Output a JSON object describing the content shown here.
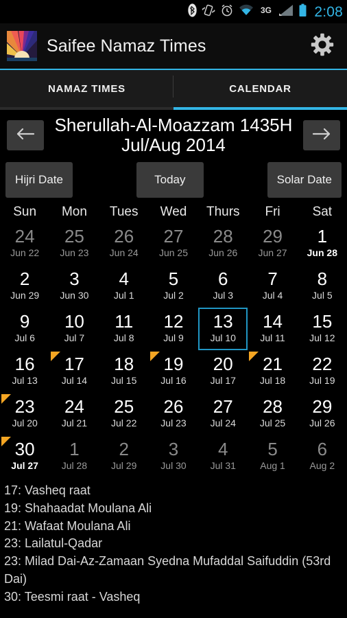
{
  "statusbar": {
    "time": "2:08",
    "icons": [
      "bluetooth-icon",
      "vibrate-icon",
      "alarm-icon",
      "wifi-icon",
      "network-3g-icon",
      "signal-icon",
      "battery-icon"
    ]
  },
  "actionbar": {
    "title": "Saifee Namaz Times",
    "logo_name": "app-logo-sunrise",
    "settings_label": "gear-icon"
  },
  "tabs": [
    {
      "label": "NAMAZ TIMES",
      "active": false
    },
    {
      "label": "CALENDAR",
      "active": true
    }
  ],
  "monthbar": {
    "prev_label": "←",
    "next_label": "→",
    "title_line1": "Sherullah-Al-Moazzam 1435H",
    "title_line2": "Jul/Aug 2014"
  },
  "modebar": {
    "hijri": "Hijri Date",
    "today": "Today",
    "solar": "Solar Date"
  },
  "calendar": {
    "weekdays": [
      "Sun",
      "Mon",
      "Tues",
      "Wed",
      "Thurs",
      "Fri",
      "Sat"
    ],
    "weeks": [
      [
        {
          "hijri": "24",
          "solar": "Jun 22",
          "out": true,
          "today": false,
          "marker": false,
          "bold": false
        },
        {
          "hijri": "25",
          "solar": "Jun 23",
          "out": true,
          "today": false,
          "marker": false,
          "bold": false
        },
        {
          "hijri": "26",
          "solar": "Jun 24",
          "out": true,
          "today": false,
          "marker": false,
          "bold": false
        },
        {
          "hijri": "27",
          "solar": "Jun 25",
          "out": true,
          "today": false,
          "marker": false,
          "bold": false
        },
        {
          "hijri": "28",
          "solar": "Jun 26",
          "out": true,
          "today": false,
          "marker": false,
          "bold": false
        },
        {
          "hijri": "29",
          "solar": "Jun 27",
          "out": true,
          "today": false,
          "marker": false,
          "bold": false
        },
        {
          "hijri": "1",
          "solar": "Jun 28",
          "out": false,
          "today": false,
          "marker": false,
          "bold": true
        }
      ],
      [
        {
          "hijri": "2",
          "solar": "Jun 29",
          "out": false,
          "today": false,
          "marker": false,
          "bold": false
        },
        {
          "hijri": "3",
          "solar": "Jun 30",
          "out": false,
          "today": false,
          "marker": false,
          "bold": false
        },
        {
          "hijri": "4",
          "solar": "Jul 1",
          "out": false,
          "today": false,
          "marker": false,
          "bold": false
        },
        {
          "hijri": "5",
          "solar": "Jul 2",
          "out": false,
          "today": false,
          "marker": false,
          "bold": false
        },
        {
          "hijri": "6",
          "solar": "Jul 3",
          "out": false,
          "today": false,
          "marker": false,
          "bold": false
        },
        {
          "hijri": "7",
          "solar": "Jul 4",
          "out": false,
          "today": false,
          "marker": false,
          "bold": false
        },
        {
          "hijri": "8",
          "solar": "Jul 5",
          "out": false,
          "today": false,
          "marker": false,
          "bold": false
        }
      ],
      [
        {
          "hijri": "9",
          "solar": "Jul 6",
          "out": false,
          "today": false,
          "marker": false,
          "bold": false
        },
        {
          "hijri": "10",
          "solar": "Jul 7",
          "out": false,
          "today": false,
          "marker": false,
          "bold": false
        },
        {
          "hijri": "11",
          "solar": "Jul 8",
          "out": false,
          "today": false,
          "marker": false,
          "bold": false
        },
        {
          "hijri": "12",
          "solar": "Jul 9",
          "out": false,
          "today": false,
          "marker": false,
          "bold": false
        },
        {
          "hijri": "13",
          "solar": "Jul 10",
          "out": false,
          "today": true,
          "marker": false,
          "bold": false
        },
        {
          "hijri": "14",
          "solar": "Jul 11",
          "out": false,
          "today": false,
          "marker": false,
          "bold": false
        },
        {
          "hijri": "15",
          "solar": "Jul 12",
          "out": false,
          "today": false,
          "marker": false,
          "bold": false
        }
      ],
      [
        {
          "hijri": "16",
          "solar": "Jul 13",
          "out": false,
          "today": false,
          "marker": false,
          "bold": false
        },
        {
          "hijri": "17",
          "solar": "Jul 14",
          "out": false,
          "today": false,
          "marker": true,
          "bold": false
        },
        {
          "hijri": "18",
          "solar": "Jul 15",
          "out": false,
          "today": false,
          "marker": false,
          "bold": false
        },
        {
          "hijri": "19",
          "solar": "Jul 16",
          "out": false,
          "today": false,
          "marker": true,
          "bold": false
        },
        {
          "hijri": "20",
          "solar": "Jul 17",
          "out": false,
          "today": false,
          "marker": false,
          "bold": false
        },
        {
          "hijri": "21",
          "solar": "Jul 18",
          "out": false,
          "today": false,
          "marker": true,
          "bold": false
        },
        {
          "hijri": "22",
          "solar": "Jul 19",
          "out": false,
          "today": false,
          "marker": false,
          "bold": false
        }
      ],
      [
        {
          "hijri": "23",
          "solar": "Jul 20",
          "out": false,
          "today": false,
          "marker": true,
          "bold": false
        },
        {
          "hijri": "24",
          "solar": "Jul 21",
          "out": false,
          "today": false,
          "marker": false,
          "bold": false
        },
        {
          "hijri": "25",
          "solar": "Jul 22",
          "out": false,
          "today": false,
          "marker": false,
          "bold": false
        },
        {
          "hijri": "26",
          "solar": "Jul 23",
          "out": false,
          "today": false,
          "marker": false,
          "bold": false
        },
        {
          "hijri": "27",
          "solar": "Jul 24",
          "out": false,
          "today": false,
          "marker": false,
          "bold": false
        },
        {
          "hijri": "28",
          "solar": "Jul 25",
          "out": false,
          "today": false,
          "marker": false,
          "bold": false
        },
        {
          "hijri": "29",
          "solar": "Jul 26",
          "out": false,
          "today": false,
          "marker": false,
          "bold": false
        }
      ],
      [
        {
          "hijri": "30",
          "solar": "Jul 27",
          "out": false,
          "today": false,
          "marker": true,
          "bold": true
        },
        {
          "hijri": "1",
          "solar": "Jul 28",
          "out": true,
          "today": false,
          "marker": false,
          "bold": false
        },
        {
          "hijri": "2",
          "solar": "Jul 29",
          "out": true,
          "today": false,
          "marker": false,
          "bold": false
        },
        {
          "hijri": "3",
          "solar": "Jul 30",
          "out": true,
          "today": false,
          "marker": false,
          "bold": false
        },
        {
          "hijri": "4",
          "solar": "Jul 31",
          "out": true,
          "today": false,
          "marker": false,
          "bold": false
        },
        {
          "hijri": "5",
          "solar": "Aug 1",
          "out": true,
          "today": false,
          "marker": false,
          "bold": false
        },
        {
          "hijri": "6",
          "solar": "Aug 2",
          "out": true,
          "today": false,
          "marker": false,
          "bold": false
        }
      ]
    ]
  },
  "events": [
    "17: Vasheq raat",
    "19: Shahaadat Moulana Ali",
    "21: Wafaat Moulana Ali",
    "23: Lailatul-Qadar",
    "23: Milad Dai-Az-Zamaan Syedna Mufaddal Saifuddin (53rd Dai)",
    "30: Teesmi raat - Vasheq"
  ],
  "colors": {
    "accent": "#33b5e5",
    "selected_border": "#2196c4",
    "marker": "#f5a623",
    "button": "#3a3a3a",
    "background": "#000000"
  }
}
